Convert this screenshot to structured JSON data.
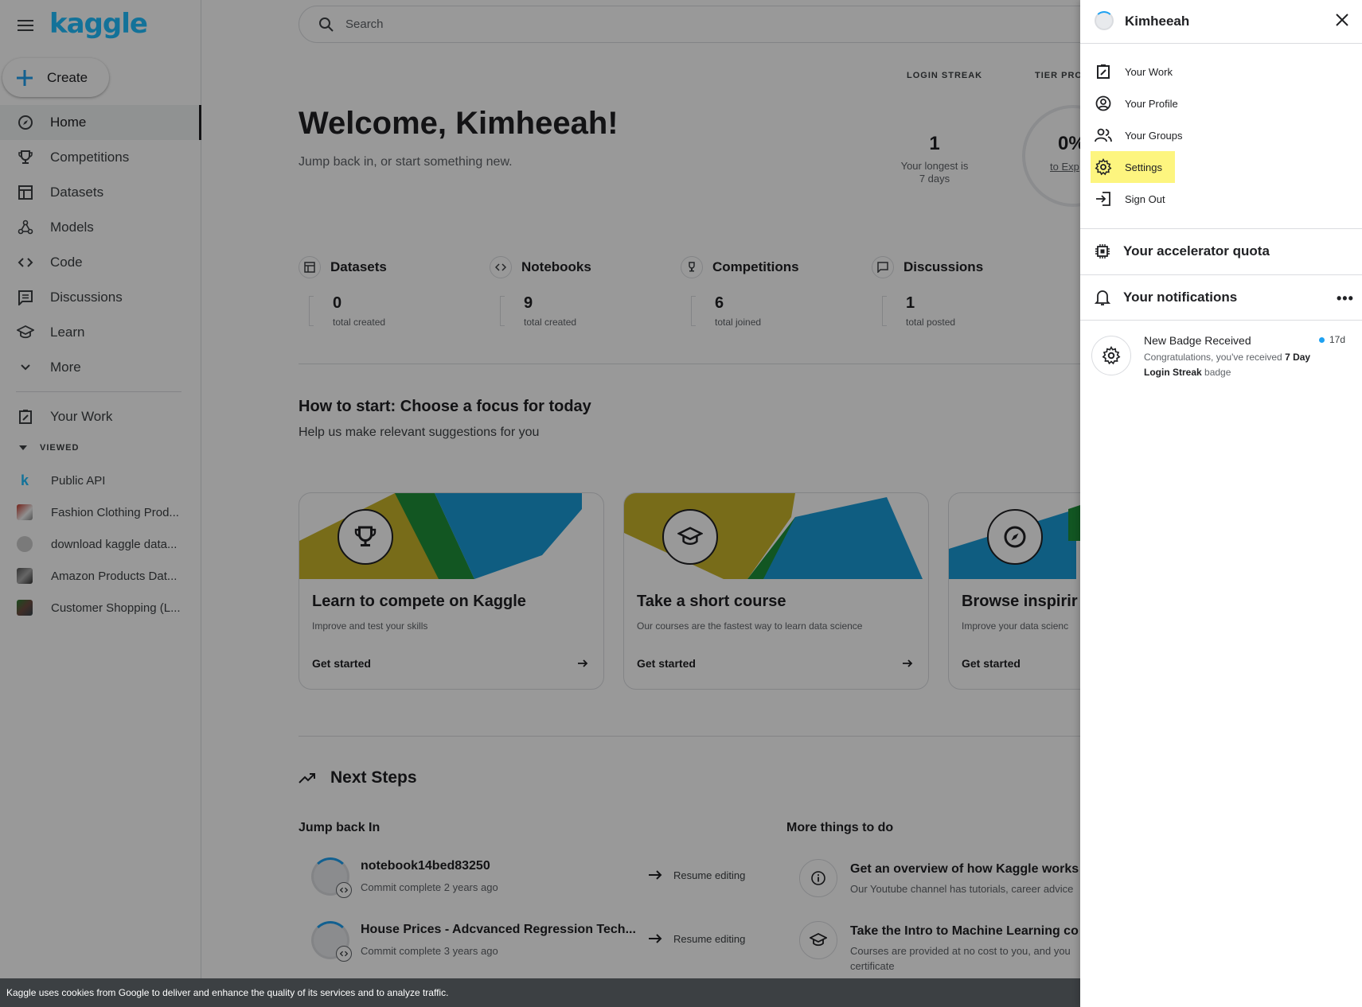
{
  "sidebar": {
    "logo": "kaggle",
    "create_label": "Create",
    "nav": [
      {
        "label": "Home",
        "icon": "compass-icon"
      },
      {
        "label": "Competitions",
        "icon": "trophy-icon"
      },
      {
        "label": "Datasets",
        "icon": "table-icon"
      },
      {
        "label": "Models",
        "icon": "models-icon"
      },
      {
        "label": "Code",
        "icon": "code-icon"
      },
      {
        "label": "Discussions",
        "icon": "comment-icon"
      },
      {
        "label": "Learn",
        "icon": "school-icon"
      },
      {
        "label": "More",
        "icon": "chevron-down-icon"
      }
    ],
    "your_work": "Your Work",
    "viewed_heading": "VIEWED",
    "viewed": [
      {
        "label": "Public API"
      },
      {
        "label": "Fashion Clothing Prod..."
      },
      {
        "label": "download kaggle data..."
      },
      {
        "label": "Amazon Products Dat..."
      },
      {
        "label": "Customer Shopping (L..."
      }
    ]
  },
  "search": {
    "placeholder": "Search"
  },
  "header": {
    "login_streak_label": "LOGIN STREAK",
    "tier_label": "TIER PROG",
    "welcome": "Welcome, Kimheeah!",
    "welcome_sub": "Jump back in, or start something new.",
    "streak_value": "1",
    "streak_desc_1": "Your longest is",
    "streak_desc_2": "7 days",
    "tier_pct": "0%",
    "tier_link": "to Exp"
  },
  "stats": [
    {
      "label": "Datasets",
      "value": "0",
      "desc": "total created"
    },
    {
      "label": "Notebooks",
      "value": "9",
      "desc": "total created"
    },
    {
      "label": "Competitions",
      "value": "6",
      "desc": "total joined"
    },
    {
      "label": "Discussions",
      "value": "1",
      "desc": "total posted"
    }
  ],
  "how_to": {
    "title": "How to start: Choose a focus for today",
    "subtitle": "Help us make relevant suggestions for you"
  },
  "cards": [
    {
      "title": "Learn to compete on Kaggle",
      "subtitle": "Improve and test your skills",
      "cta": "Get started"
    },
    {
      "title": "Take a short course",
      "subtitle": "Our courses are the fastest way to learn data science",
      "cta": "Get started"
    },
    {
      "title": "Browse inspirir",
      "subtitle": "Improve your data scienc",
      "cta": "Get started"
    }
  ],
  "next_steps": {
    "title": "Next Steps",
    "jump_title": "Jump back In",
    "more_title": "More things to do",
    "jump_items": [
      {
        "name": "notebook14bed83250",
        "meta": "Commit complete 2 years ago",
        "action": "Resume editing"
      },
      {
        "name": "House Prices - Adcvanced Regression Tech...",
        "meta": "Commit complete 3 years ago",
        "action": "Resume editing"
      }
    ],
    "more_items": [
      {
        "name": "Get an overview of how Kaggle works",
        "desc": "Our Youtube channel has tutorials, career advice"
      },
      {
        "name": "Take the Intro to Machine Learning co",
        "desc": "Courses are provided at no cost to you, and you certificate"
      }
    ]
  },
  "cookie": {
    "text": "Kaggle uses cookies from Google to deliver and enhance the quality of its services and to analyze traffic."
  },
  "panel": {
    "username": "Kimheeah",
    "menu": [
      {
        "label": "Your Work",
        "icon": "your-work-icon"
      },
      {
        "label": "Your Profile",
        "icon": "profile-icon"
      },
      {
        "label": "Your Groups",
        "icon": "groups-icon"
      },
      {
        "label": "Settings",
        "icon": "gear-icon"
      },
      {
        "label": "Sign Out",
        "icon": "sign-out-icon"
      }
    ],
    "accelerator": "Your accelerator quota",
    "notifications": "Your notifications",
    "notification": {
      "title": "New Badge Received",
      "body_1": "Congratulations, you've received ",
      "body_bold": "7 Day Login Streak",
      "body_2": " badge",
      "time": "17d"
    }
  },
  "colors": {
    "accent": "#20beff",
    "highlight": "#fdf57f",
    "dot": "#1ea1f1"
  }
}
